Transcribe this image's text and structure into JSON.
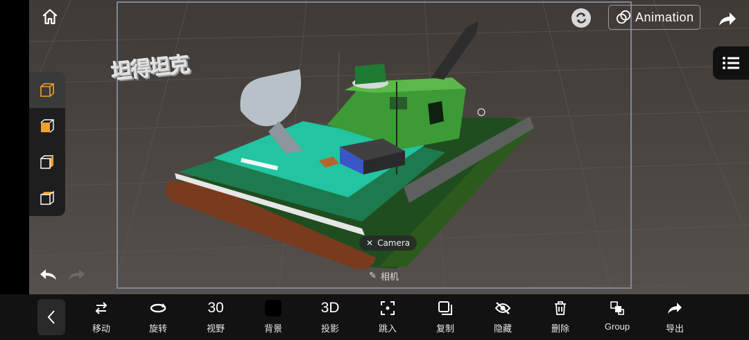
{
  "header": {
    "animation_label": "Animation"
  },
  "scene": {
    "watermark": "坦得坦克",
    "camera_tag": "Camera",
    "camera_label": "相机"
  },
  "toolbar": {
    "items": [
      {
        "icon": "move-icon",
        "value": "",
        "label": "移动"
      },
      {
        "icon": "rotate-icon",
        "value": "",
        "label": "旋转"
      },
      {
        "icon": "",
        "value": "30",
        "label": "视野"
      },
      {
        "icon": "background-swatch",
        "value": "",
        "label": "背景"
      },
      {
        "icon": "",
        "value": "3D",
        "label": "投影"
      },
      {
        "icon": "jump-in-icon",
        "value": "",
        "label": "跳入"
      },
      {
        "icon": "copy-icon",
        "value": "",
        "label": "复制"
      },
      {
        "icon": "hide-icon",
        "value": "",
        "label": "隐藏"
      },
      {
        "icon": "delete-icon",
        "value": "",
        "label": "删除"
      },
      {
        "icon": "group-icon",
        "value": "",
        "label": "Group"
      },
      {
        "icon": "export-icon",
        "value": "",
        "label": "导出"
      }
    ]
  },
  "colors": {
    "background_swatch": "#000000",
    "viewport_floor": "#4a4441",
    "accent_orange": "#f0a030"
  }
}
